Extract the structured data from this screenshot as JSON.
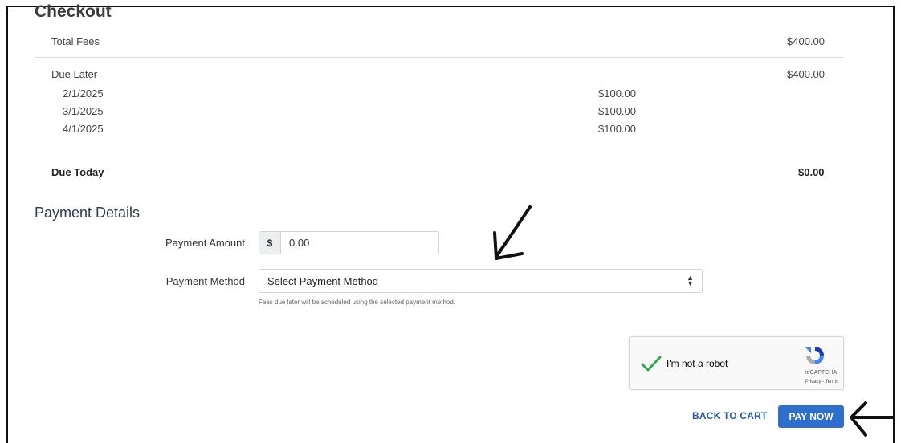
{
  "checkout": {
    "title": "Checkout",
    "total_fees_label": "Total Fees",
    "total_fees_value": "$400.00",
    "due_later_label": "Due Later",
    "due_later_value": "$400.00",
    "schedule": [
      {
        "date": "2/1/2025",
        "amount": "$100.00"
      },
      {
        "date": "3/1/2025",
        "amount": "$100.00"
      },
      {
        "date": "4/1/2025",
        "amount": "$100.00"
      }
    ],
    "due_today_label": "Due Today",
    "due_today_value": "$0.00"
  },
  "payment": {
    "section_title": "Payment Details",
    "amount_label": "Payment Amount",
    "currency_symbol": "$",
    "amount_value": "0.00",
    "method_label": "Payment Method",
    "method_selected": "Select Payment Method",
    "method_hint": "Fees due later will be scheduled using the selected payment method."
  },
  "captcha": {
    "label": "I'm not a robot",
    "brand": "reCAPTCHA",
    "links": "Privacy - Terms"
  },
  "actions": {
    "back_label": "BACK TO CART",
    "pay_label": "PAY NOW"
  },
  "colors": {
    "accent": "#2f6fce",
    "link": "#2a5aa0",
    "check": "#34a853"
  }
}
